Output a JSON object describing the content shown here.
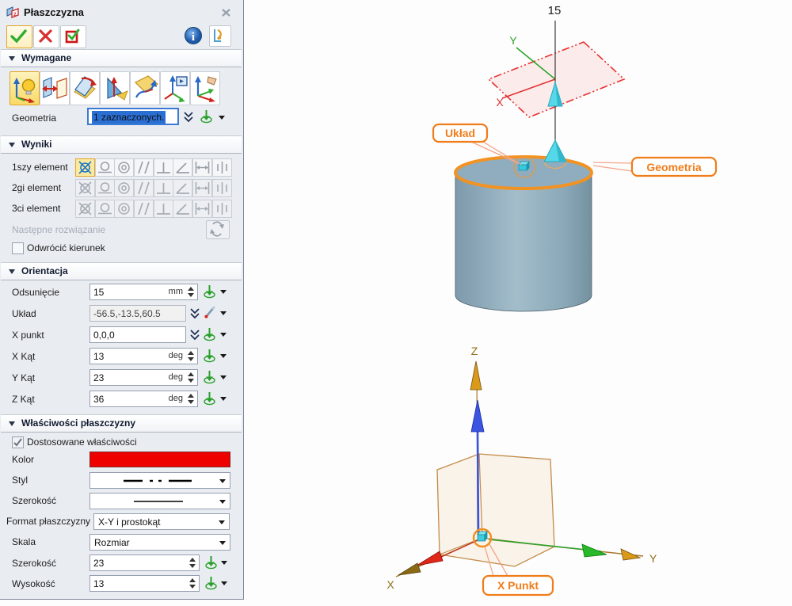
{
  "window": {
    "title": "Płaszczyzna"
  },
  "header_icons": [
    "window-plane-icon",
    "close-icon",
    "ok-check-icon",
    "cancel-cross-icon",
    "apply-checkbox-icon",
    "info-icon",
    "sidebar-flip-icon"
  ],
  "wymagane": {
    "title": "Wymagane",
    "tools": [
      "plane-dynamic",
      "plane-offset",
      "plane-angled",
      "plane-3point",
      "plane-tangent",
      "plane-view",
      "plane-dynamic-handle"
    ],
    "geometria": {
      "label": "Geometria",
      "value": "1 zaznaczonych."
    }
  },
  "wyniki": {
    "title": "Wyniki",
    "rows": [
      {
        "label": "1szy element"
      },
      {
        "label": "2gi element"
      },
      {
        "label": "3ci element"
      }
    ],
    "icons": [
      "align",
      "tangent",
      "concentric",
      "parallel",
      "perpendicular",
      "angle",
      "distance",
      "middle"
    ],
    "next_solution": "Następne rozwiązanie",
    "reverse_direction": "Odwrócić kierunek"
  },
  "orientacja": {
    "title": "Orientacja",
    "fields": [
      {
        "label": "Odsunięcie",
        "value": "15",
        "unit": "mm"
      },
      {
        "label": "Układ",
        "value": "-56.5,-13.5,60.5"
      },
      {
        "label": "X punkt",
        "value": "0,0,0"
      },
      {
        "label": "X Kąt",
        "value": "13",
        "unit": "deg"
      },
      {
        "label": "Y Kąt",
        "value": "23",
        "unit": "deg"
      },
      {
        "label": "Z Kąt",
        "value": "36",
        "unit": "deg"
      }
    ]
  },
  "wlasciwosci": {
    "title": "Właściwości płaszczyzny",
    "custom_checkbox": "Dostosowane właściwości",
    "kolor": {
      "label": "Kolor",
      "value": "#ee0000"
    },
    "styl": {
      "label": "Styl",
      "value": "dash-dot-dot"
    },
    "szerokosc_linii": {
      "label": "Szerokość",
      "value": "thin-solid"
    },
    "format": {
      "label": "Format płaszczyzny",
      "value": "X-Y i prostokąt"
    },
    "skala": {
      "label": "Skala",
      "value": "Rozmiar"
    },
    "szerokosc": {
      "label": "Szerokość",
      "value": "23"
    },
    "wysokosc": {
      "label": "Wysokość",
      "value": "13"
    }
  },
  "viewport": {
    "offset_dim": "15",
    "callouts": {
      "uklad": "Układ",
      "geometria": "Geometria",
      "x_punkt": "X Punkt"
    },
    "plane_axes": {
      "x": "X",
      "y": "Y"
    },
    "triad_axes": {
      "x": "X",
      "y": "Y",
      "z": "Z"
    },
    "colors": {
      "highlight": "#f07d1a",
      "plane_edge": "#e83030",
      "marker_cyan": "#50d4e6",
      "cylinder": "#8fadbf"
    }
  }
}
